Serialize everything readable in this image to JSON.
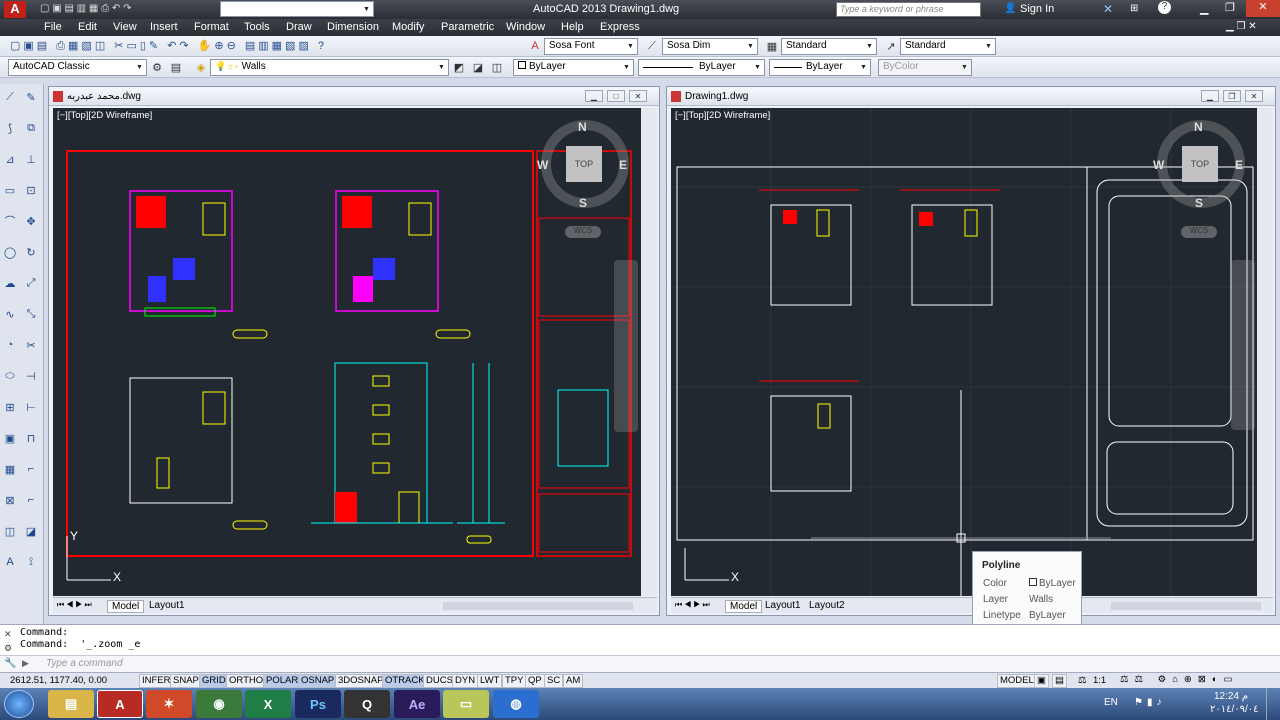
{
  "app": {
    "title": "AutoCAD 2013  Drawing1.dwg",
    "workspace": "AutoCAD Classic",
    "search_placeholder": "Type a keyword or phrase",
    "sign_in": "Sign In"
  },
  "menu": [
    "File",
    "Edit",
    "View",
    "Insert",
    "Format",
    "Tools",
    "Draw",
    "Dimension",
    "Modify",
    "Parametric",
    "Window",
    "Help",
    "Express"
  ],
  "toolbar": {
    "text_style": "Sosa Font",
    "dim_style": "Sosa Dim",
    "table_style": "Standard",
    "multileader_style": "Standard",
    "workspace2": "AutoCAD Classic",
    "layer": "Walls",
    "color": "ByLayer",
    "linetype": "ByLayer",
    "lineweight": "ByLayer",
    "plotstyle": "ByColor"
  },
  "windows": [
    {
      "title": "محمد عبدربه.dwg",
      "viewport_label": "[−][Top][2D Wireframe]",
      "tabs": [
        "Model",
        "Layout1"
      ]
    },
    {
      "title": "Drawing1.dwg",
      "viewport_label": "[−][Top][2D Wireframe]",
      "tabs": [
        "Model",
        "Layout1",
        "Layout2"
      ]
    }
  ],
  "viewcube": {
    "n": "N",
    "s": "S",
    "e": "E",
    "w": "W",
    "top": "TOP",
    "wcs": "WCS"
  },
  "ucs": {
    "x": "X",
    "y": "Y"
  },
  "tooltip": {
    "title": "Polyline",
    "rows": [
      {
        "k": "Color",
        "v": "ByLayer"
      },
      {
        "k": "Layer",
        "v": "Walls"
      },
      {
        "k": "Linetype",
        "v": "ByLayer"
      }
    ]
  },
  "command": {
    "line1": "Command:",
    "line2": "Command:  '_.zoom _e",
    "placeholder": "Type a command"
  },
  "status": {
    "coords": "2612.51, 1177.40, 0.00",
    "toggles": [
      "INFER",
      "SNAP",
      "GRID",
      "ORTHO",
      "POLAR",
      "OSNAP",
      "3DOSNAP",
      "OTRACK",
      "DUCS",
      "DYN",
      "LWT",
      "TPY",
      "QP",
      "SC",
      "AM"
    ],
    "active": [
      "GRID",
      "POLAR",
      "OSNAP",
      "OTRACK"
    ],
    "model": "MODEL",
    "scale": "1:1"
  },
  "taskbar": {
    "lang": "EN",
    "time": "12:24 م",
    "date": "٢٠١٤/٠٩/٠٤",
    "apps": [
      "Explorer",
      "AutoCAD",
      "Puzzle",
      "Chrome",
      "Excel",
      "Photoshop",
      "Q",
      "After Effects",
      "Notepad",
      "Browser"
    ]
  },
  "colors": {
    "viewport_bg": "#212830",
    "red": "#ff0000",
    "cyan": "#00ffff",
    "green": "#00ff00",
    "yellow": "#ffff00",
    "magenta": "#ff00ff",
    "blue": "#3030ff"
  }
}
